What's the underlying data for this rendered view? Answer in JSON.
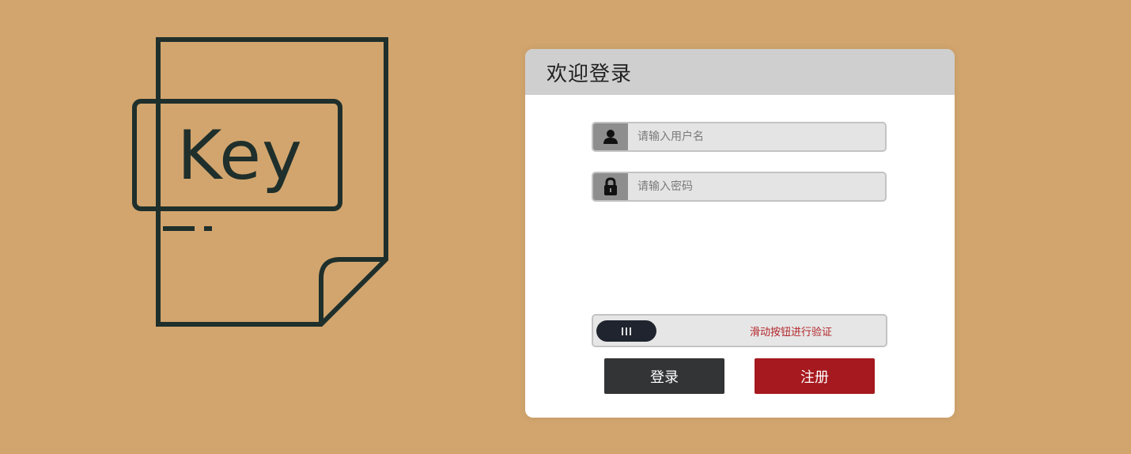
{
  "hero": {
    "text": "Key",
    "icon": "key-document-icon"
  },
  "login": {
    "title": "欢迎登录",
    "username_placeholder": "请输入用户名",
    "password_placeholder": "请输入密码",
    "slider_text": "滑动按钮进行验证",
    "login_label": "登录",
    "register_label": "注册"
  },
  "colors": {
    "background": "#d2a56e",
    "header": "#cfcfcf",
    "icon_bg": "#8e8e8e",
    "slider_handle": "#1f242e",
    "slider_text": "#b3262b",
    "login_button": "#333435",
    "register_button": "#a6191e"
  },
  "icons": {
    "username": "user-icon",
    "password": "lock-icon",
    "slider": "grip-icon"
  }
}
